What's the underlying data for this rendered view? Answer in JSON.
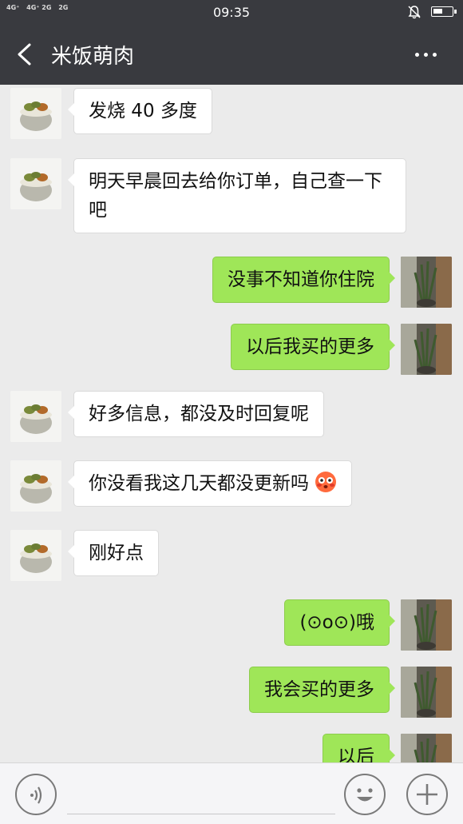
{
  "status_bar": {
    "signal_1": "4G⁺",
    "signal_2": "4G⁺ 2G",
    "signal_3": "2G",
    "time": "09:35",
    "icons": [
      "signal-icon",
      "mute-bell-icon",
      "battery-icon"
    ]
  },
  "header": {
    "back_icon": "chevron-left-icon",
    "title": "米饭萌肉",
    "more_icon": "more-dots-icon"
  },
  "colors": {
    "header_bg": "#393a3f",
    "chat_bg": "#ebebeb",
    "incoming_bubble": "#ffffff",
    "outgoing_bubble": "#9fe658"
  },
  "messages": [
    {
      "side": "in",
      "text": "发烧 40 多度"
    },
    {
      "side": "in",
      "text": "明天早晨回去给你订单，自己查一下吧"
    },
    {
      "side": "out",
      "text": "没事不知道你住院"
    },
    {
      "side": "out",
      "text": "以后我买的更多"
    },
    {
      "side": "in",
      "text": "好多信息，都没及时回复呢"
    },
    {
      "side": "in",
      "text": "你没看我这几天都没更新吗",
      "emoji": "flushed-face-icon"
    },
    {
      "side": "in",
      "text": "刚好点"
    },
    {
      "side": "out",
      "text": "(⊙o⊙)哦"
    },
    {
      "side": "out",
      "text": "我会买的更多"
    },
    {
      "side": "out",
      "text": "以后"
    }
  ],
  "input_bar": {
    "voice_icon": "voice-icon",
    "input_value": "",
    "emoji_icon": "smiley-icon",
    "plus_icon": "plus-icon"
  }
}
